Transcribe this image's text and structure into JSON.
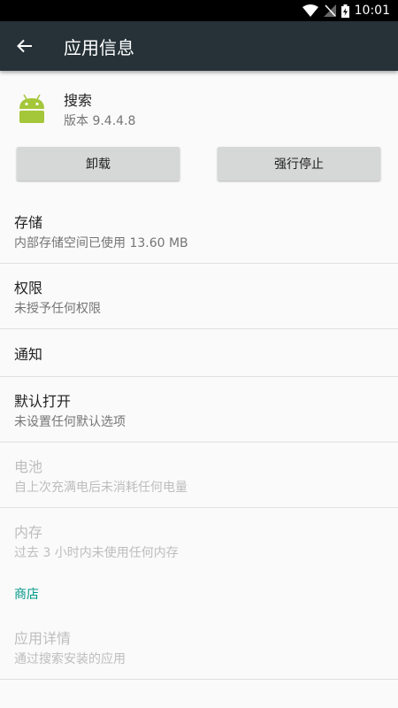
{
  "status_bar": {
    "time": "10:01"
  },
  "toolbar": {
    "title": "应用信息"
  },
  "app": {
    "name": "搜索",
    "version": "版本 9.4.4.8"
  },
  "buttons": {
    "uninstall": "卸载",
    "force_stop": "强行停止"
  },
  "items": [
    {
      "title": "存储",
      "summary": "内部存储空间已使用 13.60 MB",
      "enabled": true
    },
    {
      "title": "权限",
      "summary": "未授予任何权限",
      "enabled": true
    },
    {
      "title": "通知",
      "enabled": true
    },
    {
      "title": "默认打开",
      "summary": "未设置任何默认选项",
      "enabled": true
    },
    {
      "title": "电池",
      "summary": "自上次充满电后未消耗任何电量",
      "enabled": false
    },
    {
      "title": "内存",
      "summary": "过去 3 小时内未使用任何内存",
      "enabled": false
    }
  ],
  "store": {
    "header": "商店",
    "item": {
      "title": "应用详情",
      "summary": "通过搜索安装的应用",
      "enabled": false
    }
  },
  "colors": {
    "toolbar": "#263238",
    "accent": "#009688",
    "android_green": "#a4c639"
  }
}
